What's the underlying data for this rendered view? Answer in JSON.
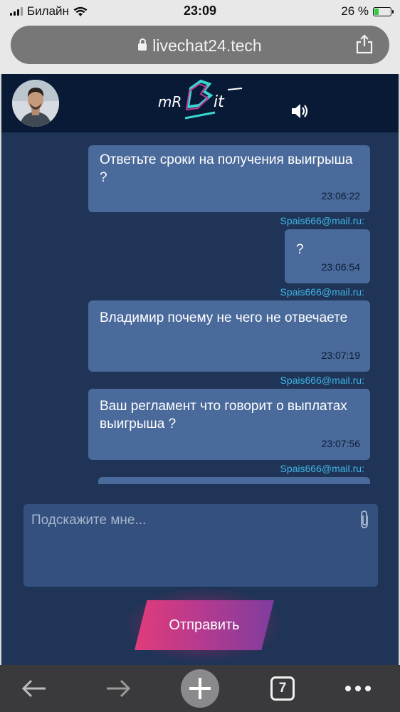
{
  "status_bar": {
    "carrier": "Билайн",
    "time": "23:09",
    "battery": "26 %",
    "battery_level": 0.26
  },
  "browser": {
    "url": "livechat24.tech",
    "tabs_count": "7"
  },
  "chat": {
    "logo_alt": "mrBit",
    "messages": [
      {
        "sender": "",
        "text": "Ответьте сроки на получения выигрыша ?",
        "time": "23:06:22"
      },
      {
        "sender": "Spais666@mail.ru:",
        "text": "?",
        "time": "23:06:54"
      },
      {
        "sender": "Spais666@mail.ru:",
        "text": "Владимир почему не чего не отвечаете",
        "time": "23:07:19"
      },
      {
        "sender": "Spais666@mail.ru:",
        "text": "Ваш регламент что говорит о выплатах выигрыша ?",
        "time": "23:07:56"
      },
      {
        "sender": "Spais666@mail.ru:",
        "text": "",
        "time": ""
      }
    ],
    "input_placeholder": "Подскажите мне...",
    "send_label": "Отправить"
  },
  "colors": {
    "chat_bg": "#1f3456",
    "header_bg": "#081a36",
    "bubble": "#4a6a9b",
    "sender": "#3fb6e8",
    "send_gradient_start": "#e23b7a",
    "send_gradient_end": "#7f3c9e"
  }
}
